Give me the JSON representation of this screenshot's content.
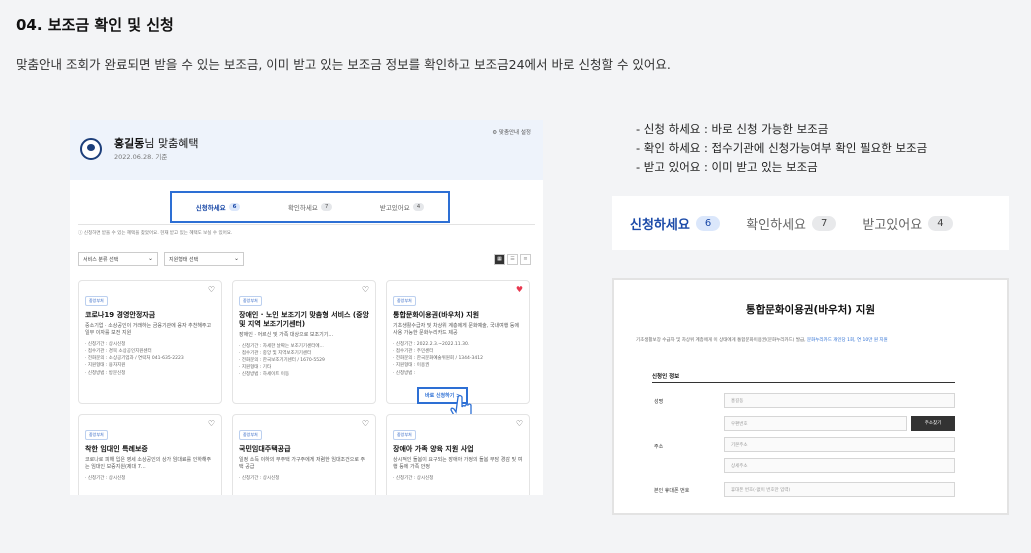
{
  "page": {
    "title": "04. 보조금 확인 및 신청",
    "description": "맞춤안내 조회가 완료되면 받을 수 있는 보조금, 이미 받고 있는 보조금 정보를 확인하고 보조금24에서 바로 신청할 수 있어요."
  },
  "mock": {
    "user_name": "홍길동",
    "user_suffix": "님 맞춤혜택",
    "date": "2022.06.28. 기준",
    "settings_link": "⚙ 맞춤안내 설정",
    "tabs": [
      {
        "label": "신청하세요",
        "count": "6"
      },
      {
        "label": "확인하세요",
        "count": "7"
      },
      {
        "label": "받고있어요",
        "count": "4"
      }
    ],
    "notice": "ⓘ 신청하면 받을 수 있는 혜택을 찾았어요. 현재 받고 있는 혜택도 보실 수 있어요.",
    "filter_service": "서비스 분류 선택",
    "filter_support": "지원형태 선택",
    "cards": [
      {
        "badge": "중앙부처",
        "title": "코로나19 경영안정자금",
        "desc": "중소기업 · 소상공인이 거래하는 금융기관에 융자 추천해주고 일부 이자를 보전 지원",
        "items": [
          "신청기간 : 상시신청",
          "접수기관 : 경북 소상공인지원센터",
          "전화문의 : 소상공기업과 / 연락처 041-635-2223",
          "지원형태 : 융자지원",
          "신청방법 : 방문신청"
        ]
      },
      {
        "badge": "중앙부처",
        "title": "장애인 · 노인 보조기기 맞춤형 서비스 (중앙 및 지역 보조기기센터)",
        "desc": "장애인 · 어르신 및 가족 대상으로 보조기기...",
        "items": [
          "신청기간 : 자세한 날짜는 보조기기센터에...",
          "접수기관 : 중앙 및 지역보조기기센터",
          "전화문의 : 한국보조기기센터 / 1670-5529",
          "지원형태 : 기타",
          "신청방법 : 하세이트 이동"
        ]
      },
      {
        "badge": "중앙부처",
        "title": "통합문화이용권(바우처) 지원",
        "desc": "기초생활수급자 및 차상위 계층에게 문화예술, 국내여행 등에 사용 가능한 문화누리카드 제공",
        "items": [
          "신청기간 : 2022.2.3.~2022.11.30.",
          "접수기관 : 주민센터",
          "전화문의 : 한국문화예술위원회 / 1344-3412",
          "지원형태 : 이용권",
          "신청방법 :"
        ]
      },
      {
        "badge": "중앙부처",
        "title": "착한 임대인 특례보증",
        "desc": "코로나로 피해 입은 영세 소상공인의 상가 임대료를 인하해주는 임대인 보증지원(제대 7...",
        "items": [
          "신청기간 : 상시신청"
        ]
      },
      {
        "badge": "중앙부처",
        "title": "국민임대주택공급",
        "desc": "일정 소득 이하의 무주택 가구주에게 저렴한 임대조건으로 주택 공급",
        "items": [
          "신청기간 : 상시신청"
        ]
      },
      {
        "badge": "중앙부처",
        "title": "장애아 가족 양육 지원 사업",
        "desc": "상시적인 돌봄이 요구되는 장애아 가정의 돌봄 부담 경감 및 여행 등에 가족 안정",
        "items": [
          "신청기간 : 상시신청"
        ]
      }
    ],
    "apply_quick": "바로 신청하기 >"
  },
  "legend": [
    "- 신청 하세요 : 바로 신청 가능한 보조금",
    "- 확인 하세요 : 접수기관에 신청가능여부 확인 필요한 보조금",
    "- 받고 있어요 : 이미 받고 있는 보조금"
  ],
  "big_tabs": [
    {
      "label": "신청하세요",
      "count": "6"
    },
    {
      "label": "확인하세요",
      "count": "7"
    },
    {
      "label": "받고있어요",
      "count": "4"
    }
  ],
  "form": {
    "title": "통합문화이용권(바우처) 지원",
    "note": "기초생활보장 수급자 및 차상위 계층에게 이 상태에게 통합문화이용권(문화누리카드) 발급,",
    "note_link": "문화누리카드 개인당 1회, 연 10만 원 지원",
    "section": "신청인 정보",
    "name_label": "성명",
    "name_value": "홍길동",
    "address_label": "주소",
    "zip_placeholder": "우편번호",
    "find_address": "주소찾기",
    "addr1_placeholder": "기본주소",
    "addr2_placeholder": "상세주소",
    "phone_label": "본인 휴대폰 번호",
    "phone_placeholder": "휴대폰 번호(-없이 번호만 입력)"
  },
  "colors": {
    "accent": "#2d6fd4",
    "active_tab": "#1b4aa8",
    "favorite": "#e8384f"
  }
}
